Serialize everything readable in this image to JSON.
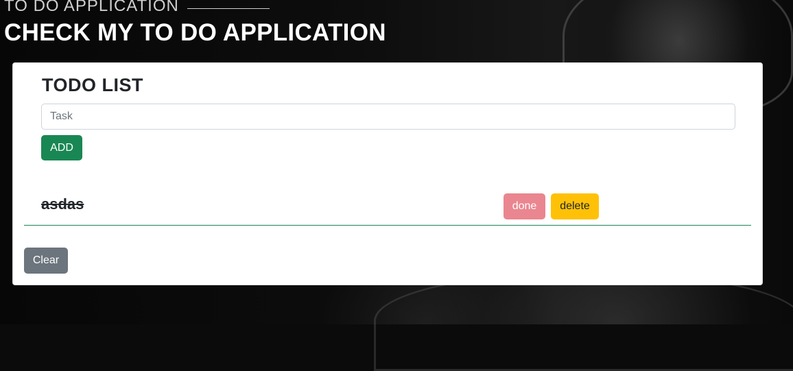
{
  "header": {
    "subtitle": "TO DO APPLICATION",
    "title": "CHECK MY TO DO APPLICATION"
  },
  "card": {
    "title": "TODO LIST",
    "task_input": {
      "placeholder": "Task",
      "value": ""
    },
    "add_label": "ADD",
    "items": [
      {
        "text": "asdas",
        "completed": true,
        "done_label": "done",
        "delete_label": "delete"
      }
    ],
    "clear_label": "Clear"
  },
  "colors": {
    "add_button": "#198754",
    "done_button": "#ea868f",
    "delete_button": "#ffc107",
    "clear_button": "#6c757d",
    "divider": "#198754"
  }
}
